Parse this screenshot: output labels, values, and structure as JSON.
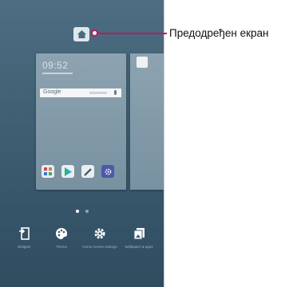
{
  "callout": {
    "label": "Предодређен екран"
  },
  "preview": {
    "clock": "09:52",
    "search_label": "Google",
    "apps": [
      "grid-app-icon",
      "play-store-icon",
      "pen-app-icon",
      "settings-app-icon"
    ]
  },
  "pager": {
    "current": 1,
    "total": 2
  },
  "bottom_menu": [
    {
      "icon": "widgets-icon",
      "label": "Widgets"
    },
    {
      "icon": "theme-icon",
      "label": "Theme"
    },
    {
      "icon": "gear-icon",
      "label": "Home screen settings"
    },
    {
      "icon": "wallpaper-icon",
      "label": "Wallpaper & apps"
    }
  ],
  "colors": {
    "accent": "#c2185b",
    "screen_bg": "#3e5e72"
  }
}
